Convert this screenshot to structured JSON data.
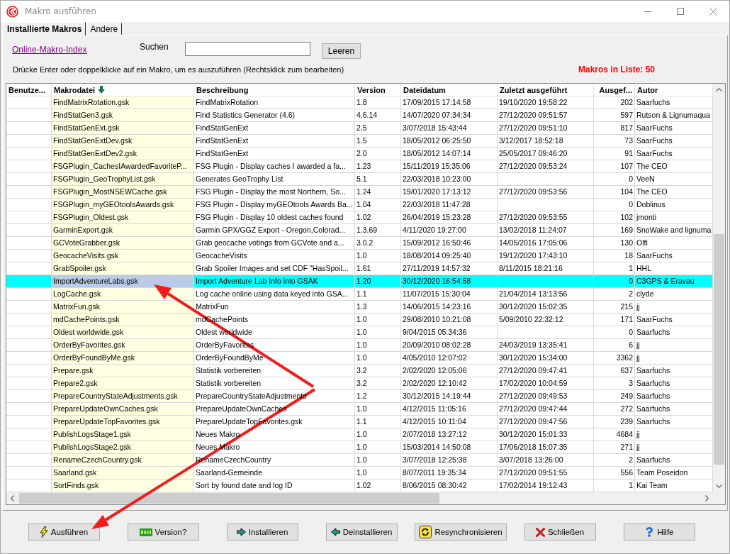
{
  "window": {
    "title": "Makro ausführen"
  },
  "tabs": [
    {
      "label": "Installierte Makros",
      "selected": true
    },
    {
      "label": "Andere",
      "selected": false
    }
  ],
  "toolbar": {
    "link": "Online-Makro-Index",
    "search": {
      "label": "Suchen"
    },
    "clear_button": "Leeren"
  },
  "hint": "Drücke Enter oder doppelklicke auf ein Makro, um es auszuführen (Rechtsklick zum bearbeiten)",
  "macro_count": "Makros in Liste: 50",
  "table": {
    "columns": [
      {
        "label": "Benutze...",
        "kind": "text",
        "sorted": false
      },
      {
        "label": "Makrodatei",
        "kind": "file",
        "sorted": true
      },
      {
        "label": "Beschreibung",
        "kind": "text",
        "sorted": false
      },
      {
        "label": "Version",
        "kind": "text",
        "sorted": false
      },
      {
        "label": "Dateidatum",
        "kind": "text",
        "sorted": false
      },
      {
        "label": "Zuletzt ausgeführt",
        "kind": "text",
        "sorted": false
      },
      {
        "label": "Ausgef...",
        "kind": "number",
        "sorted": false
      },
      {
        "label": "Autor",
        "kind": "text",
        "sorted": false
      }
    ],
    "rows": [
      {
        "file": "FindMatrixRotation.gsk",
        "description": "FindMatrixRotation",
        "version": "1.8",
        "file_date": "17/09/2015 17:14:58",
        "last_run": "19/10/2020 19:58:22",
        "runs": "202",
        "author": "Saarfuchs",
        "selected": false
      },
      {
        "file": "FindStatGen3.gsk",
        "description": "Find Statistics Generator (4.6)",
        "version": "4.6.14",
        "file_date": "14/07/2020 07:34:34",
        "last_run": "27/12/2020 09:51:57",
        "runs": "597",
        "author": "Rutson & Lignumaqua",
        "selected": false
      },
      {
        "file": "FindStatGenExt.gsk",
        "description": "FindStatGenExt",
        "version": "2.5",
        "file_date": "3/07/2018 15:43:44",
        "last_run": "27/12/2020 09:51:10",
        "runs": "817",
        "author": "SaarFuchs",
        "selected": false
      },
      {
        "file": "FindStatGenExtDev.gsk",
        "description": "FindStatGenExt",
        "version": "1.5",
        "file_date": "18/05/2012 06:25:50",
        "last_run": "3/12/2017 18:52:18",
        "runs": "73",
        "author": "SaarFuchs",
        "selected": false
      },
      {
        "file": "FindStatGenExtDev2.gsk",
        "description": "FindStatGenExt",
        "version": "2.0",
        "file_date": "18/05/2012 14:07:14",
        "last_run": "25/05/2017 09:46:20",
        "runs": "91",
        "author": "SaarFuchs",
        "selected": false
      },
      {
        "file": "FSGPlugin_CachesIAwardedFavoriteP...",
        "description": "FSG Plugin - Display caches I awarded a fa...",
        "version": "1.23",
        "file_date": "15/11/2019 15:35:06",
        "last_run": "27/12/2020 09:53:24",
        "runs": "107",
        "author": "The CEO",
        "selected": false
      },
      {
        "file": "FSGPlugin_GeoTrophyList.gsk",
        "description": "Generates GeoTrophy List",
        "version": "5.1",
        "file_date": "22/03/2018 10:23:00",
        "runs": "0",
        "author": "VeeN",
        "selected": false
      },
      {
        "file": "FSGPlugin_MostNSEWCache.gsk",
        "description": "FSG Plugin - Display the most Northern, So...",
        "version": "1.24",
        "file_date": "19/01/2020 17:13:12",
        "last_run": "27/12/2020 09:53:56",
        "runs": "104",
        "author": "The CEO",
        "selected": false
      },
      {
        "file": "FSGPlugin_myGEOtoolsAwards.gsk",
        "description": "FSG Plugin - Display myGEOtools Awards Ba...",
        "version": "1.04",
        "file_date": "22/03/2018 11:47:28",
        "runs": "0",
        "author": "Doblinus",
        "selected": false
      },
      {
        "file": "FSGPlugin_Oldest.gsk",
        "description": "FSG Plugin - Display 10 oldest caches found",
        "version": "1.02",
        "file_date": "26/04/2019 15:23:28",
        "last_run": "27/12/2020 09:53:55",
        "runs": "102",
        "author": "jmonti",
        "selected": false
      },
      {
        "file": "GarminExport.gsk",
        "description": "Garmin GPX/GGZ Export  - Oregon,Colorad...",
        "version": "1.3.69",
        "file_date": "4/11/2020 19:27:00",
        "last_run": "13/02/2018 11:24:07",
        "runs": "169",
        "author": "SnoWake and lignuma",
        "selected": false
      },
      {
        "file": "GCVoteGrabber.gsk",
        "description": "Grab geocache votings from GCVote and a...",
        "version": "3.0.2",
        "file_date": "15/09/2012 16:50:46",
        "last_run": "14/05/2016 17:05:06",
        "runs": "130",
        "author": "Olfi",
        "selected": false
      },
      {
        "file": "GeocacheVisits.gsk",
        "description": "GeocacheVisits",
        "version": "1.0",
        "file_date": "18/08/2014 09:25:40",
        "last_run": "19/12/2020 17:43:10",
        "runs": "18",
        "author": "SaarFuchs",
        "selected": false
      },
      {
        "file": "GrabSpoiler.gsk",
        "description": "Grab Spoiler Images and set CDF \"HasSpoil...",
        "version": "1.61",
        "file_date": "27/11/2019 14:57:32",
        "last_run": "8/11/2015 18:21:16",
        "runs": "1",
        "author": "HHL",
        "selected": false
      },
      {
        "file": "ImportAdventureLabs.gsk",
        "description": "Import Adventure Lab Info into GSAK",
        "version": "1.20",
        "file_date": "30/12/2020 16:54:58",
        "runs": "0",
        "author": "C3GPS & Eravau",
        "selected": true
      },
      {
        "file": "LogCache.gsk",
        "description": "Log cache online using data keyed into GSA...",
        "version": "1.1",
        "file_date": "11/07/2015 15:30:04",
        "last_run": "21/04/2014 13:13:56",
        "runs": "2",
        "author": "clyde",
        "selected": false
      },
      {
        "file": "MatrixFun.gsk",
        "description": "MatrixFun",
        "version": "1.3",
        "file_date": "14/06/2015 14:23:16",
        "last_run": "30/12/2020 15:02:35",
        "runs": "215",
        "author": "jj",
        "selected": false
      },
      {
        "file": "mdCachePoints.gsk",
        "description": "mdCachePoints",
        "version": "1.0",
        "file_date": "29/08/2010 10:21:08",
        "last_run": "5/09/2010 22:32:12",
        "runs": "171",
        "author": "SaarFuchs",
        "selected": false
      },
      {
        "file": "Oldest worldwide.gsk",
        "description": "Oldest worldwide",
        "version": "1.0",
        "file_date": "9/04/2015 05:34:36",
        "runs": "0",
        "author": "Saarfuchs",
        "selected": false
      },
      {
        "file": "OrderByFavorites.gsk",
        "description": "OrderByFavorites",
        "version": "1.0",
        "file_date": "20/09/2010 08:02:28",
        "last_run": "24/03/2019 13:35:41",
        "runs": "6",
        "author": "jj",
        "selected": false
      },
      {
        "file": "OrderByFoundByMe.gsk",
        "description": "OrderByFoundByMe",
        "version": "1.0",
        "file_date": "4/05/2010 12:07:02",
        "last_run": "30/12/2020 15:34:00",
        "runs": "3362",
        "author": "jj",
        "selected": false
      },
      {
        "file": "Prepare.gsk",
        "description": "Statistik vorbereiten",
        "version": "3.2",
        "file_date": "2/02/2020 12:05:06",
        "last_run": "27/12/2020 09:47:41",
        "runs": "637",
        "author": "Saarfuchs",
        "selected": false
      },
      {
        "file": "Prepare2.gsk",
        "description": "Statistik vorbereiten",
        "version": "3.2",
        "file_date": "2/02/2020 12:10:42",
        "last_run": "17/02/2020 10:04:59",
        "runs": "3",
        "author": "Saarfuchs",
        "selected": false
      },
      {
        "file": "PrepareCountryStateAdjustments.gsk",
        "description": "PrepareCountryStateAdjustments",
        "version": "1.2",
        "file_date": "30/12/2015 14:19:44",
        "last_run": "27/12/2020 09:49:53",
        "runs": "249",
        "author": "Saarfuchs",
        "selected": false
      },
      {
        "file": "PrepareUpdateOwnCaches.gsk",
        "description": "PrepareUpdateOwnCaches",
        "version": "1.0",
        "file_date": "4/12/2015 11:05:16",
        "last_run": "27/12/2020 09:47:44",
        "runs": "272",
        "author": "Saarfuchs",
        "selected": false
      },
      {
        "file": "PrepareUpdateTopFavorites.gsk",
        "description": "PrepareUpdateTopFavorites.gsk",
        "version": "1.1",
        "file_date": "4/12/2015 10:11:04",
        "last_run": "27/12/2020 09:47:56",
        "runs": "239",
        "author": "Saarfuchs",
        "selected": false
      },
      {
        "file": "PublishLogsStage1.gsk",
        "description": "Neues Makro",
        "version": "1.0",
        "file_date": "2/07/2018 13:27:12",
        "last_run": "30/12/2020 15:01:33",
        "runs": "4684",
        "author": "jj",
        "selected": false
      },
      {
        "file": "PublishLogsStage2.gsk",
        "description": "Neues Makro",
        "version": "1.0",
        "file_date": "15/03/2014 14:50:08",
        "last_run": "17/06/2018 15:07:35",
        "runs": "271",
        "author": "jj",
        "selected": false
      },
      {
        "file": "RenameCzechCountry.gsk",
        "description": "RenameCzechCountry",
        "version": "1.0",
        "file_date": "3/07/2018 12:25:38",
        "last_run": "3/07/2018 13:26:00",
        "runs": "2",
        "author": "Saarfuchs",
        "selected": false
      },
      {
        "file": "Saarland.gsk",
        "description": "Saarland-Gemeinde",
        "version": "1.0",
        "file_date": "8/07/2011 19:35:34",
        "last_run": "27/12/2020 09:51:55",
        "runs": "556",
        "author": "Team Poseidon",
        "selected": false
      },
      {
        "file": "SortFinds.gsk",
        "description": "Sort by found date and log ID",
        "version": "1.02",
        "file_date": "8/06/2015 08:30:42",
        "last_run": "17/02/2014 19:12:43",
        "runs": "1",
        "author": "Kai Team",
        "selected": false
      }
    ]
  },
  "buttons": [
    {
      "label": "Ausführen",
      "kind": "run"
    },
    {
      "label": "Version?",
      "kind": "version"
    },
    {
      "label": "Installieren",
      "kind": "install"
    },
    {
      "label": "Deinstallieren",
      "kind": "uninstall"
    },
    {
      "label": "Resynchronisieren",
      "kind": "resync"
    },
    {
      "label": "Schließen",
      "kind": "close"
    },
    {
      "label": "Hilfe",
      "kind": "help"
    }
  ],
  "annotations": [
    {
      "kind": "arrow"
    },
    {
      "kind": "arrow"
    }
  ]
}
